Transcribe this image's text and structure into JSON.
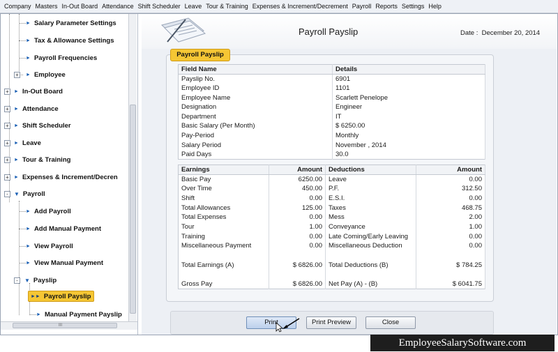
{
  "menu": [
    "Company",
    "Masters",
    "In-Out Board",
    "Attendance",
    "Shift Scheduler",
    "Leave",
    "Tour & Training",
    "Expenses & Increment/Decrement",
    "Payroll",
    "Reports",
    "Settings",
    "Help"
  ],
  "sidebar": {
    "items": [
      {
        "label": "Salary Parameter Settings"
      },
      {
        "label": "Tax & Allowance Settings"
      },
      {
        "label": "Payroll Frequencies"
      },
      {
        "label": "Employee"
      },
      {
        "label": "In-Out Board"
      },
      {
        "label": "Attendance"
      },
      {
        "label": "Shift Scheduler"
      },
      {
        "label": "Leave"
      },
      {
        "label": "Tour & Training"
      },
      {
        "label": "Expenses & Increment/Decren"
      },
      {
        "label": "Payroll"
      },
      {
        "label": "Add Payroll"
      },
      {
        "label": "Add Manual Payment"
      },
      {
        "label": "View Payroll"
      },
      {
        "label": "View Manual Payment"
      },
      {
        "label": "Payslip"
      },
      {
        "label": "Payroll Payslip"
      },
      {
        "label": "Manual Payment Payslip"
      }
    ],
    "hscroll_grip": "III"
  },
  "header": {
    "title": "Payroll Payslip",
    "date_prefix": "Date :",
    "date_value": "December 20, 2014"
  },
  "card": {
    "tab_label": "Payroll Payslip",
    "info_headers": [
      "Field Name",
      "Details"
    ],
    "info_rows": [
      [
        "Payslip No.",
        "6901"
      ],
      [
        "Employee ID",
        "1101"
      ],
      [
        "Employee Name",
        "Scarlett Penelope"
      ],
      [
        "Designation",
        "Engineer"
      ],
      [
        "Department",
        "IT"
      ],
      [
        "Basic Salary (Per Month)",
        "$ 6250.00"
      ],
      [
        "Pay-Period",
        "Monthly"
      ],
      [
        "Salary Period",
        "November , 2014"
      ],
      [
        "Paid Days",
        "30.0"
      ]
    ],
    "earn_headers": [
      "Earnings",
      "Amount",
      "Deductions",
      "Amount"
    ],
    "earn_rows": [
      [
        "Basic Pay",
        "6250.00",
        "Leave",
        "0.00"
      ],
      [
        "Over Time",
        "450.00",
        "P.F.",
        "312.50"
      ],
      [
        "Shift",
        "0.00",
        "E.S.I.",
        "0.00"
      ],
      [
        "Total Allowances",
        "125.00",
        "Taxes",
        "468.75"
      ],
      [
        "Total Expenses",
        "0.00",
        "Mess",
        "2.00"
      ],
      [
        "Tour",
        "1.00",
        "Conveyance",
        "1.00"
      ],
      [
        "Training",
        "0.00",
        "Late Coming/Early Leaving",
        "0.00"
      ],
      [
        "Miscellaneous Payment",
        "0.00",
        "Miscellaneous Deduction",
        "0.00"
      ]
    ],
    "totals": [
      "Total Earnings (A)",
      "$ 6826.00",
      "Total Deductions (B)",
      "$ 784.25"
    ],
    "net": [
      "Gross Pay",
      "$ 6826.00",
      "Net Pay (A) - (B)",
      "$ 6041.75"
    ]
  },
  "buttons": {
    "print": "Print",
    "preview": "Print Preview",
    "close": "Close"
  },
  "watermark": "EmployeeSalarySoftware.com",
  "colors": {
    "highlight": "#f5c634",
    "accent": "#1a5fb4"
  }
}
